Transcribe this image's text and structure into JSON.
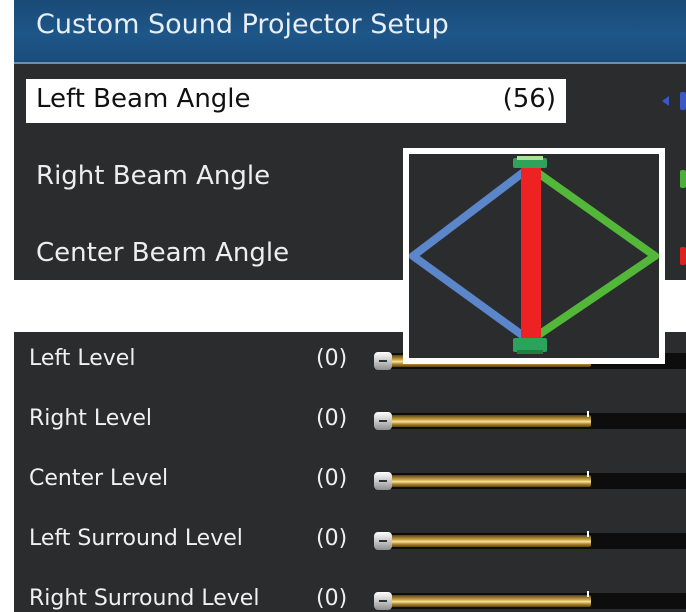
{
  "header": {
    "title": "Custom Sound Projector Setup"
  },
  "beam_settings": [
    {
      "label": "Left Beam Angle",
      "value": "(56)",
      "selected": true,
      "indicator_color": "#3a58c8"
    },
    {
      "label": "Right Beam Angle",
      "value": "",
      "selected": false,
      "indicator_color": "#4caf3a"
    },
    {
      "label": "Center Beam Angle",
      "value": "",
      "selected": false,
      "indicator_color": "#e02020"
    }
  ],
  "beam_diagram": {
    "colors": {
      "left": "#5b86c9",
      "right": "#53b83a",
      "center": "#ee2222"
    }
  },
  "levels": [
    {
      "label": "Left Level",
      "value": "(0)",
      "fill": 0.68
    },
    {
      "label": "Right Level",
      "value": "(0)",
      "fill": 0.68
    },
    {
      "label": "Center Level",
      "value": "(0)",
      "fill": 0.68
    },
    {
      "label": "Left Surround Level",
      "value": "(0)",
      "fill": 0.68
    },
    {
      "label": "Right Surround Level",
      "value": "(0)",
      "fill": 0.68
    }
  ]
}
